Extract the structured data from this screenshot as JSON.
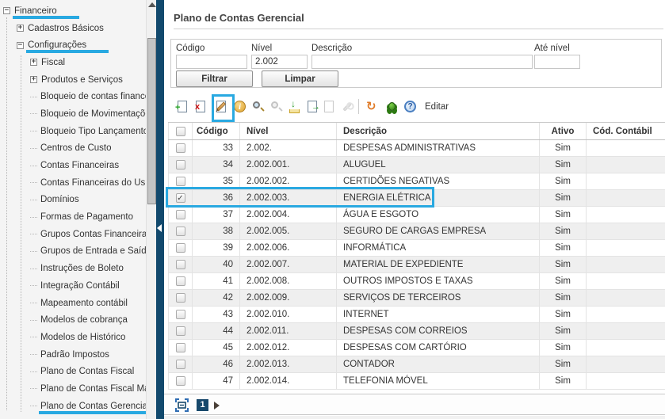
{
  "colors": {
    "annotation": "#29a9e1",
    "splitter_navy": "#12496d",
    "pagination_navy": "#17486b"
  },
  "sidebar": {
    "items": [
      {
        "label": "Financeiro",
        "level": 0,
        "expander": "minus",
        "underlined": true,
        "selected": false
      },
      {
        "label": "Cadastros Básicos",
        "level": 1,
        "expander": "plus",
        "underlined": false,
        "selected": false
      },
      {
        "label": "Configurações",
        "level": 1,
        "expander": "minus",
        "underlined": true,
        "selected": false
      },
      {
        "label": "Fiscal",
        "level": 2,
        "expander": "plus",
        "underlined": false,
        "selected": false
      },
      {
        "label": "Produtos e Serviços",
        "level": 2,
        "expander": "plus",
        "underlined": false,
        "selected": false
      },
      {
        "label": "Bloqueio de contas finance",
        "level": 2,
        "expander": null,
        "underlined": false,
        "selected": false
      },
      {
        "label": "Bloqueio de Movimentaçõe",
        "level": 2,
        "expander": null,
        "underlined": false,
        "selected": false
      },
      {
        "label": "Bloqueio Tipo Lançamento",
        "level": 2,
        "expander": null,
        "underlined": false,
        "selected": false
      },
      {
        "label": "Centros de Custo",
        "level": 2,
        "expander": null,
        "underlined": false,
        "selected": false
      },
      {
        "label": "Contas Financeiras",
        "level": 2,
        "expander": null,
        "underlined": false,
        "selected": false
      },
      {
        "label": "Contas Financeiras do Usu",
        "level": 2,
        "expander": null,
        "underlined": false,
        "selected": false
      },
      {
        "label": "Domínios",
        "level": 2,
        "expander": null,
        "underlined": false,
        "selected": false
      },
      {
        "label": "Formas de Pagamento",
        "level": 2,
        "expander": null,
        "underlined": false,
        "selected": false
      },
      {
        "label": "Grupos Contas Financeira",
        "level": 2,
        "expander": null,
        "underlined": false,
        "selected": false
      },
      {
        "label": "Grupos de Entrada e Saída",
        "level": 2,
        "expander": null,
        "underlined": false,
        "selected": false
      },
      {
        "label": "Instruções de Boleto",
        "level": 2,
        "expander": null,
        "underlined": false,
        "selected": false
      },
      {
        "label": "Integração Contábil",
        "level": 2,
        "expander": null,
        "underlined": false,
        "selected": false
      },
      {
        "label": "Mapeamento contábil",
        "level": 2,
        "expander": null,
        "underlined": false,
        "selected": false
      },
      {
        "label": "Modelos de cobrança",
        "level": 2,
        "expander": null,
        "underlined": false,
        "selected": false
      },
      {
        "label": "Modelos de Histórico",
        "level": 2,
        "expander": null,
        "underlined": false,
        "selected": false
      },
      {
        "label": "Padrão Impostos",
        "level": 2,
        "expander": null,
        "underlined": false,
        "selected": false
      },
      {
        "label": "Plano de Contas Fiscal",
        "level": 2,
        "expander": null,
        "underlined": false,
        "selected": false
      },
      {
        "label": "Plano de Contas Fiscal Ma",
        "level": 2,
        "expander": null,
        "underlined": false,
        "selected": false
      },
      {
        "label": "Plano de Contas Gerencial",
        "level": 2,
        "expander": null,
        "underlined": false,
        "selected": true
      }
    ]
  },
  "main": {
    "title": "Plano de Contas Gerencial",
    "filter": {
      "codigo_label": "Código",
      "codigo_value": "",
      "nivel_label": "Nível",
      "nivel_value": "2.002",
      "descricao_label": "Descrição",
      "descricao_value": "",
      "ate_nivel_label": "Até nível",
      "ate_nivel_value": "",
      "filtrar_button": "Filtrar",
      "limpar_button": "Limpar"
    },
    "toolbar": {
      "edit_label": "Editar",
      "icons": [
        {
          "name": "add-record-icon",
          "type": "add",
          "disabled": false,
          "highlighted": false
        },
        {
          "name": "delete-record-icon",
          "type": "del",
          "disabled": false,
          "highlighted": false
        },
        {
          "name": "edit-record-icon",
          "type": "edit",
          "disabled": false,
          "highlighted": true
        },
        {
          "name": "info-icon",
          "type": "info",
          "disabled": false,
          "highlighted": false
        },
        {
          "name": "zoom-in-icon",
          "type": "lens",
          "disabled": false,
          "highlighted": false
        },
        {
          "name": "zoom-out-icon",
          "type": "lens",
          "disabled": true,
          "highlighted": false
        },
        {
          "name": "import-icon",
          "type": "import",
          "disabled": false,
          "highlighted": false
        },
        {
          "name": "export-icon",
          "type": "export",
          "disabled": false,
          "highlighted": false
        },
        {
          "name": "report-icon",
          "type": "report",
          "disabled": true,
          "highlighted": false
        },
        {
          "name": "tools-icon",
          "type": "wrench",
          "disabled": true,
          "highlighted": false
        },
        {
          "name": "toolbar-separator",
          "type": "sep",
          "disabled": false,
          "highlighted": false
        },
        {
          "name": "refresh-icon",
          "type": "refresh",
          "disabled": false,
          "highlighted": false
        },
        {
          "name": "debug-icon",
          "type": "bug",
          "disabled": false,
          "highlighted": false
        },
        {
          "name": "help-icon",
          "type": "help",
          "disabled": false,
          "highlighted": false
        }
      ]
    },
    "table": {
      "columns": {
        "codigo": "Código",
        "nivel": "Nível",
        "descricao": "Descrição",
        "ativo": "Ativo",
        "cod_contabil": "Cód. Contábil"
      },
      "rows": [
        {
          "codigo": "33",
          "nivel": "2.002.",
          "descricao": "DESPESAS ADMINISTRATIVAS",
          "ativo": "Sim",
          "cod_contabil": "",
          "checked": false
        },
        {
          "codigo": "34",
          "nivel": "2.002.001.",
          "descricao": "ALUGUEL",
          "ativo": "Sim",
          "cod_contabil": "",
          "checked": false
        },
        {
          "codigo": "35",
          "nivel": "2.002.002.",
          "descricao": "CERTIDÕES NEGATIVAS",
          "ativo": "Sim",
          "cod_contabil": "",
          "checked": false
        },
        {
          "codigo": "36",
          "nivel": "2.002.003.",
          "descricao": "ENERGIA ELÉTRICA",
          "ativo": "Sim",
          "cod_contabil": "",
          "checked": true
        },
        {
          "codigo": "37",
          "nivel": "2.002.004.",
          "descricao": "ÁGUA E ESGOTO",
          "ativo": "Sim",
          "cod_contabil": "",
          "checked": false
        },
        {
          "codigo": "38",
          "nivel": "2.002.005.",
          "descricao": "SEGURO DE CARGAS EMPRESA",
          "ativo": "Sim",
          "cod_contabil": "",
          "checked": false
        },
        {
          "codigo": "39",
          "nivel": "2.002.006.",
          "descricao": "INFORMÁTICA",
          "ativo": "Sim",
          "cod_contabil": "",
          "checked": false
        },
        {
          "codigo": "40",
          "nivel": "2.002.007.",
          "descricao": "MATERIAL DE EXPEDIENTE",
          "ativo": "Sim",
          "cod_contabil": "",
          "checked": false
        },
        {
          "codigo": "41",
          "nivel": "2.002.008.",
          "descricao": "OUTROS IMPOSTOS E TAXAS",
          "ativo": "Sim",
          "cod_contabil": "",
          "checked": false
        },
        {
          "codigo": "42",
          "nivel": "2.002.009.",
          "descricao": "SERVIÇOS DE TERCEIROS",
          "ativo": "Sim",
          "cod_contabil": "",
          "checked": false
        },
        {
          "codigo": "43",
          "nivel": "2.002.010.",
          "descricao": "INTERNET",
          "ativo": "Sim",
          "cod_contabil": "",
          "checked": false
        },
        {
          "codigo": "44",
          "nivel": "2.002.011.",
          "descricao": "DESPESAS COM CORREIOS",
          "ativo": "Sim",
          "cod_contabil": "",
          "checked": false
        },
        {
          "codigo": "45",
          "nivel": "2.002.012.",
          "descricao": "DESPESAS COM CARTÓRIO",
          "ativo": "Sim",
          "cod_contabil": "",
          "checked": false
        },
        {
          "codigo": "46",
          "nivel": "2.002.013.",
          "descricao": "CONTADOR",
          "ativo": "Sim",
          "cod_contabil": "",
          "checked": false
        },
        {
          "codigo": "47",
          "nivel": "2.002.014.",
          "descricao": "TELEFONIA MÓVEL",
          "ativo": "Sim",
          "cod_contabil": "",
          "checked": false
        }
      ]
    },
    "pagination": {
      "page": "1"
    }
  }
}
